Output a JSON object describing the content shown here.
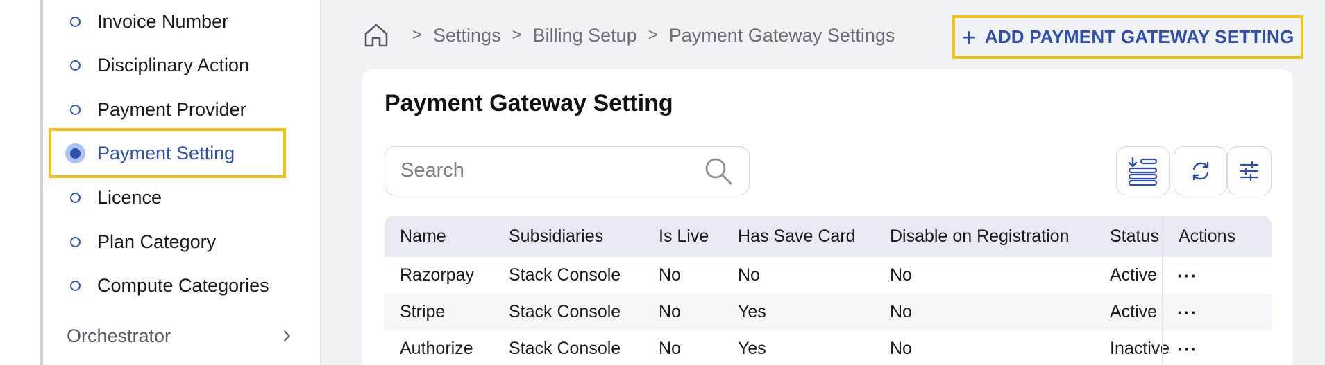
{
  "sidebar": {
    "items": [
      {
        "label": "Invoice Number"
      },
      {
        "label": "Disciplinary Action"
      },
      {
        "label": "Payment Provider"
      },
      {
        "label": "Payment Setting"
      },
      {
        "label": "Licence"
      },
      {
        "label": "Plan Category"
      },
      {
        "label": "Compute Categories"
      }
    ],
    "active_index": 3,
    "group": {
      "label": "Orchestrator"
    }
  },
  "breadcrumb": {
    "items": [
      "Settings",
      "Billing Setup",
      "Payment Gateway Settings"
    ]
  },
  "header": {
    "add_button_label": "ADD PAYMENT GATEWAY SETTING"
  },
  "card": {
    "title": "Payment Gateway Setting",
    "search": {
      "placeholder": "Search",
      "value": ""
    }
  },
  "table": {
    "columns": [
      "Name",
      "Subsidiaries",
      "Is Live",
      "Has Save Card",
      "Disable on Registration",
      "Status",
      "Actions"
    ],
    "rows": [
      [
        "Razorpay",
        "Stack Console",
        "No",
        "No",
        "No",
        "Active"
      ],
      [
        "Stripe",
        "Stack Console",
        "No",
        "Yes",
        "No",
        "Active"
      ],
      [
        "Authorize",
        "Stack Console",
        "No",
        "Yes",
        "No",
        "Inactive"
      ]
    ],
    "actions_glyph": "···"
  },
  "colors": {
    "accent": "#2f4fa8",
    "highlight": "#f2c21a",
    "header_bg": "#e7eaf2"
  },
  "icons": [
    "home-icon",
    "chevron-right-icon",
    "plus-icon",
    "search-icon",
    "export-icon",
    "refresh-icon",
    "filter-sliders-icon",
    "more-dots-icon"
  ]
}
